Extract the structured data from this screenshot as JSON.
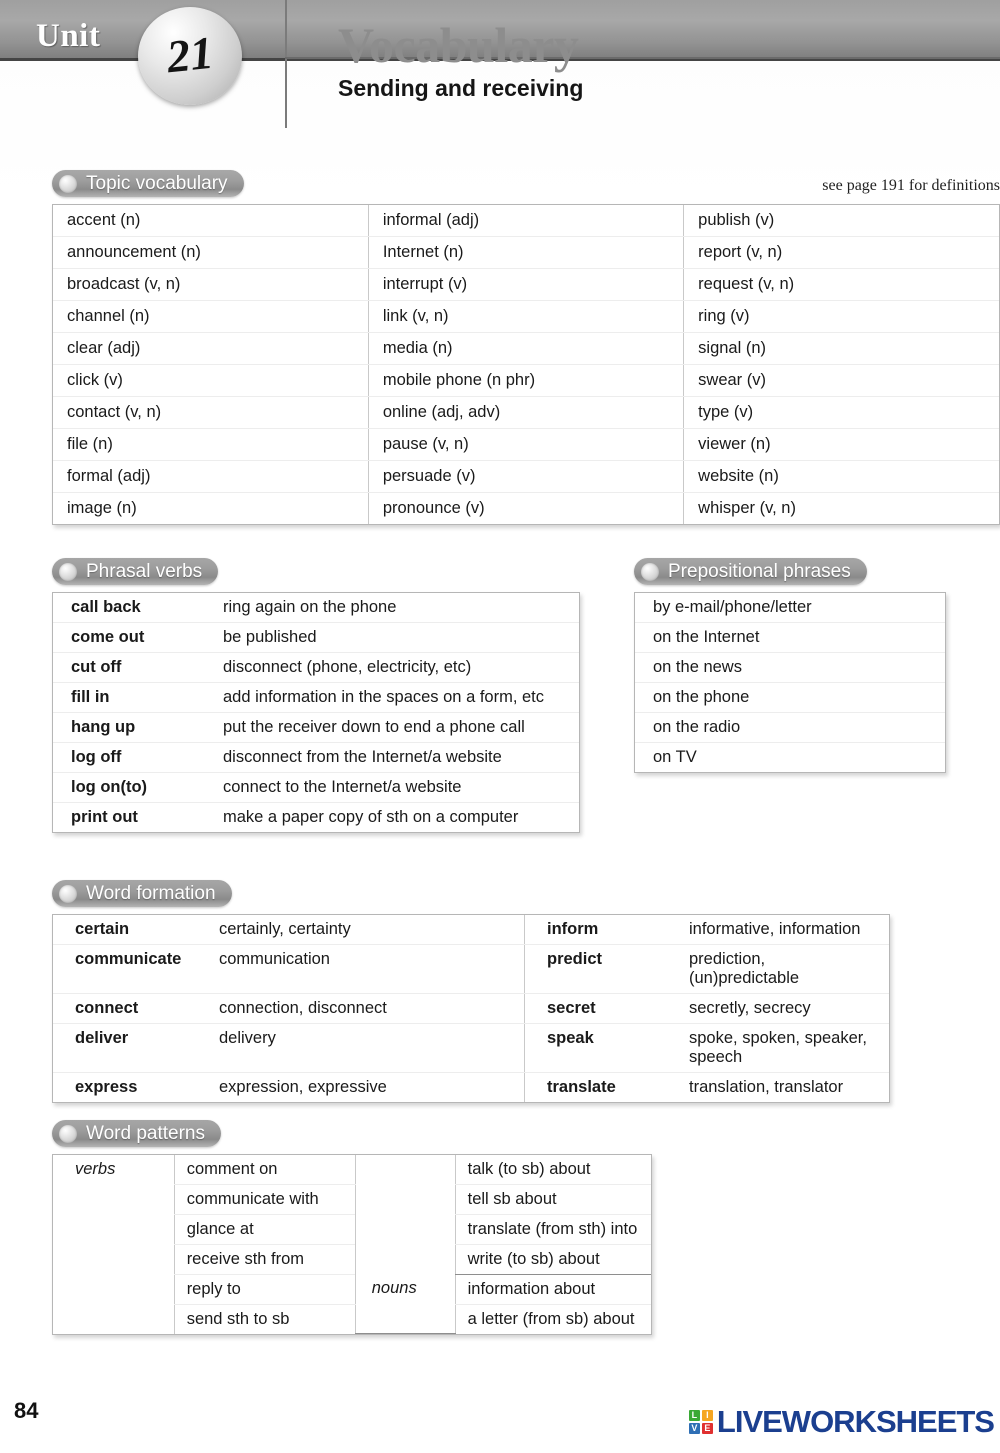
{
  "header": {
    "unit_label": "Unit",
    "unit_number": "21",
    "title": "Vocabulary",
    "subtitle": "Sending and receiving"
  },
  "topic_vocabulary": {
    "section_title": "Topic vocabulary",
    "note": "see page 191 for definitions",
    "columns": [
      [
        "accent (n)",
        "announcement (n)",
        "broadcast (v, n)",
        "channel (n)",
        "clear (adj)",
        "click (v)",
        "contact (v, n)",
        "file (n)",
        "formal (adj)",
        "image (n)"
      ],
      [
        "informal (adj)",
        "Internet (n)",
        "interrupt (v)",
        "link (v, n)",
        "media (n)",
        "mobile phone (n phr)",
        "online (adj, adv)",
        "pause (v, n)",
        "persuade (v)",
        "pronounce (v)"
      ],
      [
        "publish (v)",
        "report (v, n)",
        "request (v, n)",
        "ring (v)",
        "signal (n)",
        "swear (v)",
        "type (v)",
        "viewer (n)",
        "website (n)",
        "whisper (v, n)"
      ]
    ]
  },
  "phrasal_verbs": {
    "section_title": "Phrasal verbs",
    "rows": [
      {
        "term": "call back",
        "definition": "ring again on the phone"
      },
      {
        "term": "come out",
        "definition": "be published"
      },
      {
        "term": "cut off",
        "definition": "disconnect (phone, electricity, etc)"
      },
      {
        "term": "fill in",
        "definition": "add information in the spaces on a form, etc"
      },
      {
        "term": "hang up",
        "definition": "put the receiver down to end a phone call"
      },
      {
        "term": "log off",
        "definition": "disconnect from the Internet/a website"
      },
      {
        "term": "log on(to)",
        "definition": "connect to the Internet/a website"
      },
      {
        "term": "print out",
        "definition": "make a paper copy of sth on a computer"
      }
    ]
  },
  "prepositional_phrases": {
    "section_title": "Prepositional phrases",
    "items": [
      "by e-mail/phone/letter",
      "on the Internet",
      "on the news",
      "on the phone",
      "on the radio",
      "on TV"
    ]
  },
  "word_formation": {
    "section_title": "Word formation",
    "rows": [
      {
        "term": "certain",
        "derivatives": "certainly, certainty",
        "term2": "inform",
        "derivatives2": "informative, information"
      },
      {
        "term": "communicate",
        "derivatives": "communication",
        "term2": "predict",
        "derivatives2": "prediction, (un)predictable"
      },
      {
        "term": "connect",
        "derivatives": "connection, disconnect",
        "term2": "secret",
        "derivatives2": "secretly, secrecy"
      },
      {
        "term": "deliver",
        "derivatives": "delivery",
        "term2": "speak",
        "derivatives2": "spoke, spoken, speaker, speech"
      },
      {
        "term": "express",
        "derivatives": "expression, expressive",
        "term2": "translate",
        "derivatives2": "translation, translator"
      }
    ]
  },
  "word_patterns": {
    "section_title": "Word patterns",
    "verbs_label": "verbs",
    "nouns_label": "nouns",
    "rows": [
      {
        "left": "comment on",
        "right": "talk (to sb) about"
      },
      {
        "left": "communicate with",
        "right": "tell sb about"
      },
      {
        "left": "glance at",
        "right": "translate (from sth) into"
      },
      {
        "left": "receive sth from",
        "right": "write (to sb) about"
      },
      {
        "left": "reply to",
        "right": "information about"
      },
      {
        "left": "send sth to sb",
        "right": "a letter (from sb) about"
      }
    ]
  },
  "footer": {
    "page_number": "84",
    "brand_letters": {
      "l": "L",
      "i": "I",
      "v": "V",
      "e": "E"
    },
    "brand_name": "LIVEWORKSHEETS"
  },
  "colors": {
    "band_gray": "#8e8e8e",
    "title_gray": "#8d8d8d",
    "pill_gray": "#9c9c9c",
    "brand_blue": "#1b3f8f",
    "brand_green": "#3aa935",
    "brand_orange": "#f5a623",
    "brand_red": "#e03030"
  }
}
